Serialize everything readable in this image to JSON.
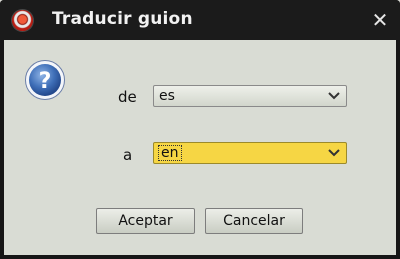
{
  "window": {
    "title": "Traducir guion",
    "app_icon": "record-icon",
    "close_icon": "close-icon",
    "close_glyph": "✕"
  },
  "dialog": {
    "icon": "question-icon",
    "from_label": "de",
    "from_value": "es",
    "to_label": "a",
    "to_value": "en",
    "accent_color": "#f6d644"
  },
  "buttons": {
    "ok_label": "Aceptar",
    "cancel_label": "Cancelar"
  }
}
